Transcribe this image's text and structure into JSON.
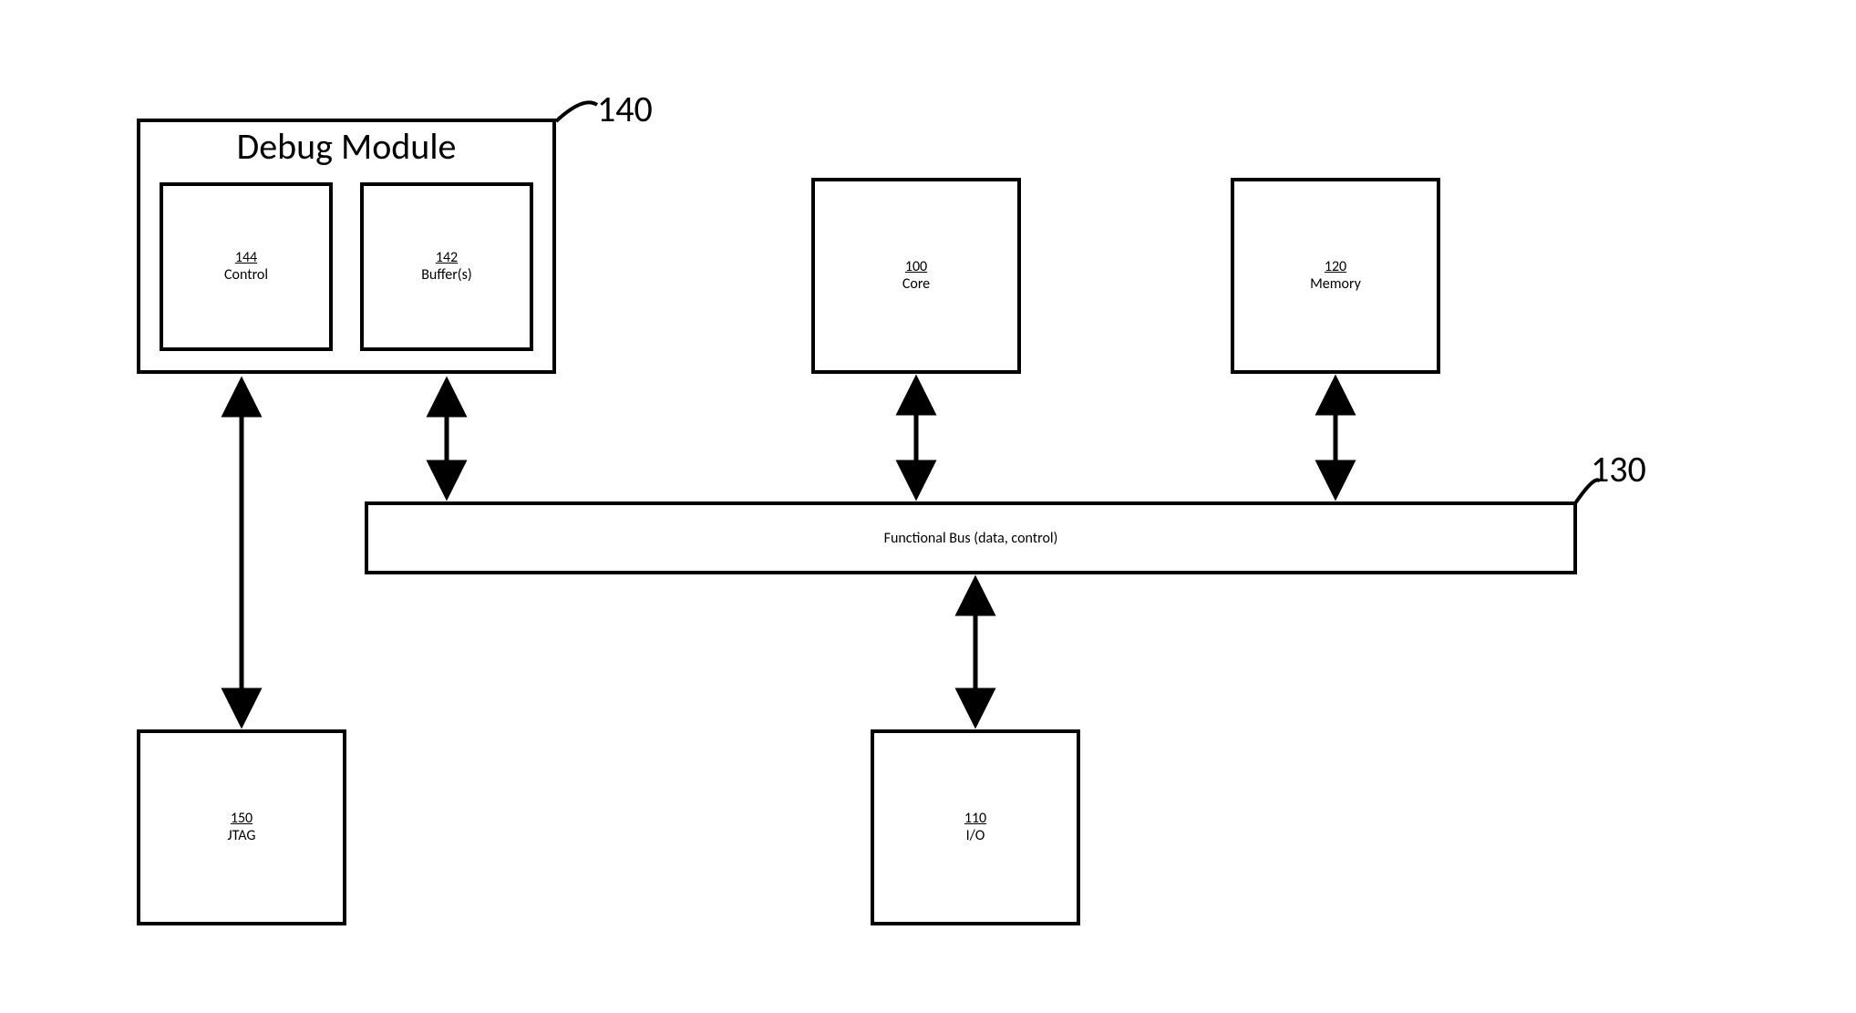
{
  "debugModule": {
    "title": "Debug Module",
    "ref": "140",
    "control": {
      "ref": "144",
      "name": "Control"
    },
    "buffers": {
      "ref": "142",
      "name": "Buffer(s)"
    }
  },
  "core": {
    "ref": "100",
    "name": "Core"
  },
  "memory": {
    "ref": "120",
    "name": "Memory"
  },
  "bus": {
    "ref": "130",
    "name": "Functional Bus (data, control)"
  },
  "jtag": {
    "ref": "150",
    "name": "JTAG"
  },
  "io": {
    "ref": "110",
    "name": "I/O"
  }
}
